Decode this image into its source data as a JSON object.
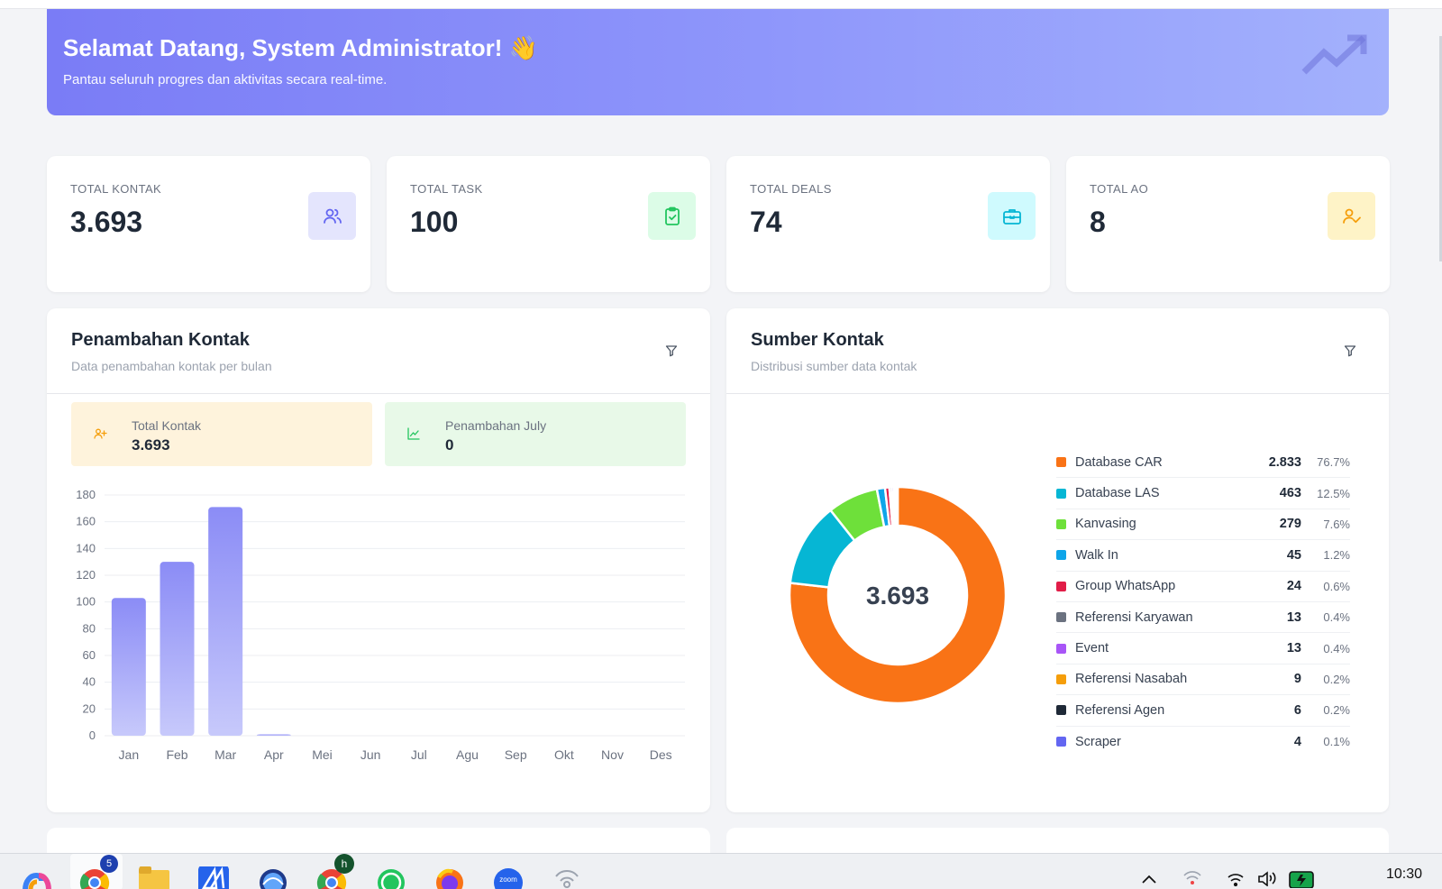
{
  "hero": {
    "title": "Selamat Datang, System Administrator! 👋",
    "subtitle": "Pantau seluruh progres dan aktivitas secara real-time."
  },
  "stats": [
    {
      "label": "TOTAL KONTAK",
      "value": "3.693",
      "icon": "users-icon",
      "color": "#6366f1",
      "bg": "#e4e5fd"
    },
    {
      "label": "TOTAL TASK",
      "value": "100",
      "icon": "clipboard-check-icon",
      "color": "#22c55e",
      "bg": "#dcfce7"
    },
    {
      "label": "TOTAL DEALS",
      "value": "74",
      "icon": "briefcase-icon",
      "color": "#06b6d4",
      "bg": "#cffafe"
    },
    {
      "label": "TOTAL AO",
      "value": "8",
      "icon": "user-check-icon",
      "color": "#f59e0b",
      "bg": "#fef3c7"
    }
  ],
  "contacts_panel": {
    "title": "Penambahan Kontak",
    "subtitle": "Data penambahan kontak per bulan",
    "summary": [
      {
        "label": "Total Kontak",
        "value": "3.693",
        "color": "#f59e0b",
        "bg": "#fef3dc"
      },
      {
        "label": "Penambahan July",
        "value": "0",
        "color": "#22c55e",
        "bg": "#e8f9e8"
      }
    ]
  },
  "source_panel": {
    "title": "Sumber Kontak",
    "subtitle": "Distribusi sumber data kontak",
    "center_label": "3.693"
  },
  "chart_data": [
    {
      "type": "bar",
      "categories": [
        "Jan",
        "Feb",
        "Mar",
        "Apr",
        "Mei",
        "Jun",
        "Jul",
        "Agu",
        "Sep",
        "Okt",
        "Nov",
        "Des"
      ],
      "values": [
        103,
        130,
        171,
        1,
        0,
        0,
        0,
        0,
        0,
        0,
        0,
        0
      ],
      "ylim": [
        0,
        180
      ],
      "yticks": [
        0,
        20,
        40,
        60,
        80,
        100,
        120,
        140,
        160,
        180
      ],
      "grid": true,
      "color": "#8b8cf6"
    },
    {
      "type": "pie",
      "donut": true,
      "slices": [
        {
          "label": "Database CAR",
          "value": 2833,
          "value_text": "2.833",
          "pct": "76.7%",
          "color": "#f97316"
        },
        {
          "label": "Database LAS",
          "value": 463,
          "value_text": "463",
          "pct": "12.5%",
          "color": "#06b6d4"
        },
        {
          "label": "Kanvasing",
          "value": 279,
          "value_text": "279",
          "pct": "7.6%",
          "color": "#6ee03a"
        },
        {
          "label": "Walk In",
          "value": 45,
          "value_text": "45",
          "pct": "1.2%",
          "color": "#0ea5e9"
        },
        {
          "label": "Group WhatsApp",
          "value": 24,
          "value_text": "24",
          "pct": "0.6%",
          "color": "#e11d48"
        },
        {
          "label": "Referensi Karyawan",
          "value": 13,
          "value_text": "13",
          "pct": "0.4%",
          "color": "#6b7280"
        },
        {
          "label": "Event",
          "value": 13,
          "value_text": "13",
          "pct": "0.4%",
          "color": "#a855f7"
        },
        {
          "label": "Referensi Nasabah",
          "value": 9,
          "value_text": "9",
          "pct": "0.2%",
          "color": "#f59e0b"
        },
        {
          "label": "Referensi Agen",
          "value": 6,
          "value_text": "6",
          "pct": "0.2%",
          "color": "#1f2937"
        },
        {
          "label": "Scraper",
          "value": 4,
          "value_text": "4",
          "pct": "0.1%",
          "color": "#6366f1"
        }
      ]
    }
  ],
  "taskbar": {
    "apps": [
      "copilot-icon",
      "chrome-icon",
      "file-explorer-icon",
      "app-icon",
      "browser-icon",
      "chrome-profile-icon",
      "whatsapp-icon",
      "firefox-icon",
      "zoom-icon",
      "hotspot-icon"
    ],
    "badges": {
      "chrome": "5",
      "chrome_profile": "h"
    },
    "zoom_label": "zoom",
    "clock": "10:30"
  }
}
